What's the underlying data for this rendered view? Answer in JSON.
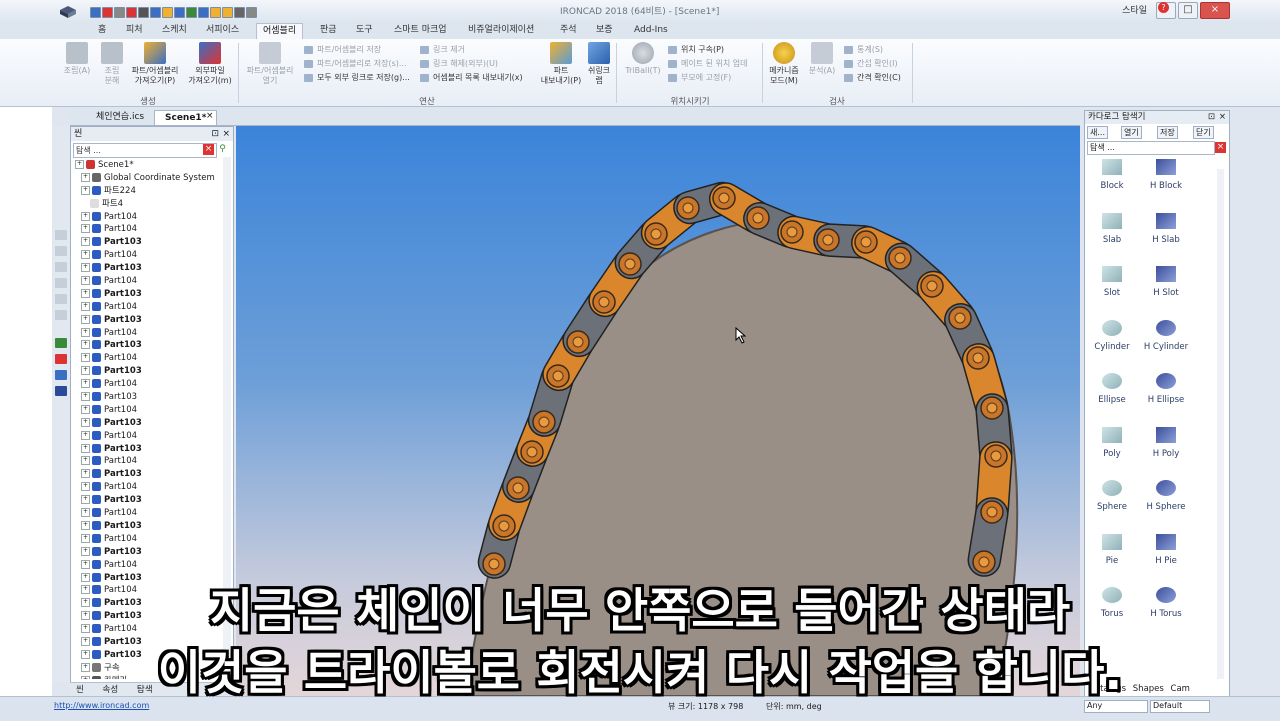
{
  "window": {
    "title": "IRONCAD 2018 (64비트) - [Scene1*]"
  },
  "quick_access": {
    "count": 14
  },
  "tabs": [
    "홈",
    "피처",
    "스케치",
    "서피이스",
    "어셈블리",
    "판금",
    "도구",
    "스마트 마크업",
    "비쥬얼라이제이션",
    "주석",
    "보증",
    "Add-Ins"
  ],
  "active_tab": "어셈블리",
  "style_label": "스타일",
  "help": "?",
  "ribbon": {
    "group1_label": "생성",
    "group2_label": "연산",
    "group3_label": "위치시키기",
    "group4_label": "검사",
    "assemble": "조립(A)",
    "disassemble": "조립\n분해",
    "import_part": "파트/어셈블리\n가져오기(P)",
    "import_external": "외부파일\n가져오기(m)",
    "open_part": "파트/어셈블리\n열기",
    "save_part": "파트/어셈블리 저장",
    "save_part_as": "파트/어셈블리로 저장(s)...",
    "save_external_links": "모두 외부 링크로 저장(g)...",
    "link_remove": "링크 제거",
    "link_break": "링크 해제(외부)(U)",
    "export_assembly_list": "어셈블리 목록 내보내기(x)",
    "part_export": "파트\n내보내기(P)",
    "shrinkwrap": "쉬링크\n랩",
    "triball": "TriBall(T)",
    "position_constraint": "위치 구속(P)",
    "update_position": "메이트 된 위치 업데",
    "fix_part": "부모에 고정(F)",
    "mechanism_mode": "메카니즘\n모드(M)",
    "analysis": "분석(A)",
    "statistics": "통계(S)",
    "interference": "간섭 확인(I)",
    "clearance": "간격 확인(C)"
  },
  "document_tabs": [
    "체인연습.ics",
    "Scene1*"
  ],
  "active_document": "Scene1*",
  "scene_panel": {
    "title": "씬",
    "search_placeholder": "탐색 ...",
    "tree": [
      {
        "label": "Scene1*",
        "bold": false,
        "icon": "scene"
      },
      {
        "label": "Global Coordinate System",
        "bold": false,
        "icon": "axes"
      },
      {
        "label": "파트224",
        "bold": false,
        "icon": "part"
      },
      {
        "label": "파트4",
        "bold": false,
        "icon": "sheet"
      },
      {
        "label": "Part104",
        "bold": false,
        "icon": "part"
      },
      {
        "label": "Part104",
        "bold": false,
        "icon": "part"
      },
      {
        "label": "Part103",
        "bold": true,
        "icon": "part"
      },
      {
        "label": "Part104",
        "bold": false,
        "icon": "part"
      },
      {
        "label": "Part103",
        "bold": true,
        "icon": "part"
      },
      {
        "label": "Part104",
        "bold": false,
        "icon": "part"
      },
      {
        "label": "Part103",
        "bold": true,
        "icon": "part"
      },
      {
        "label": "Part104",
        "bold": false,
        "icon": "part"
      },
      {
        "label": "Part103",
        "bold": true,
        "icon": "part"
      },
      {
        "label": "Part104",
        "bold": false,
        "icon": "part"
      },
      {
        "label": "Part103",
        "bold": true,
        "icon": "part"
      },
      {
        "label": "Part104",
        "bold": false,
        "icon": "part"
      },
      {
        "label": "Part103",
        "bold": true,
        "icon": "part"
      },
      {
        "label": "Part104",
        "bold": false,
        "icon": "part"
      },
      {
        "label": "Part103",
        "bold": false,
        "icon": "part"
      },
      {
        "label": "Part104",
        "bold": false,
        "icon": "part"
      },
      {
        "label": "Part103",
        "bold": true,
        "icon": "part"
      },
      {
        "label": "Part104",
        "bold": false,
        "icon": "part"
      },
      {
        "label": "Part103",
        "bold": true,
        "icon": "part"
      },
      {
        "label": "Part104",
        "bold": false,
        "icon": "part"
      },
      {
        "label": "Part103",
        "bold": true,
        "icon": "part"
      },
      {
        "label": "Part104",
        "bold": false,
        "icon": "part"
      },
      {
        "label": "Part103",
        "bold": true,
        "icon": "part"
      },
      {
        "label": "Part104",
        "bold": false,
        "icon": "part"
      },
      {
        "label": "Part103",
        "bold": true,
        "icon": "part"
      },
      {
        "label": "Part104",
        "bold": false,
        "icon": "part"
      },
      {
        "label": "Part103",
        "bold": true,
        "icon": "part"
      },
      {
        "label": "Part104",
        "bold": false,
        "icon": "part"
      },
      {
        "label": "Part103",
        "bold": true,
        "icon": "part"
      },
      {
        "label": "Part104",
        "bold": false,
        "icon": "part"
      },
      {
        "label": "Part103",
        "bold": true,
        "icon": "part"
      },
      {
        "label": "Part103",
        "bold": true,
        "icon": "part"
      },
      {
        "label": "Part104",
        "bold": false,
        "icon": "part"
      },
      {
        "label": "Part103",
        "bold": true,
        "icon": "part"
      },
      {
        "label": "Part103",
        "bold": true,
        "icon": "part"
      },
      {
        "label": "구속",
        "bold": false,
        "icon": "constraint"
      },
      {
        "label": "카메라",
        "bold": false,
        "icon": "camera"
      }
    ],
    "bottom_tabs": [
      "씬",
      "속성",
      "탐색"
    ]
  },
  "catalog": {
    "title": "카다로그 탐색기",
    "buttons": [
      "새...",
      "열기",
      "저장",
      "닫기"
    ],
    "search_placeholder": "탐색 ...",
    "shapes": [
      "Block",
      "H Block",
      "Slab",
      "H Slab",
      "Slot",
      "H Slot",
      "Cylinder",
      "H Cylinder",
      "Ellipse",
      "H Ellipse",
      "Poly",
      "H Poly",
      "Sphere",
      "H Sphere",
      "Pie",
      "H Pie",
      "Torus",
      "H Torus"
    ],
    "bottom_tabs": [
      "Catalogs",
      "Shapes",
      "Cam"
    ]
  },
  "status": {
    "url": "http://www.ironcad.com",
    "view_size": "뷰 크기: 1178 x 798",
    "units": "단위: mm, deg",
    "select_any": "Any",
    "select_default": "Default"
  },
  "subtitle": {
    "line1": "지금은 체인이 너무 안쪽으로 들어간 상태라",
    "line2": "이것을 트라이볼로 회전시켜 다시 작업을 합니다."
  },
  "colors": {
    "link_orange": "#d9862c",
    "link_gray": "#6c7078",
    "pin_orange": "#c9762a",
    "gear_face": "#998f86",
    "sky_top": "#3b84da"
  }
}
